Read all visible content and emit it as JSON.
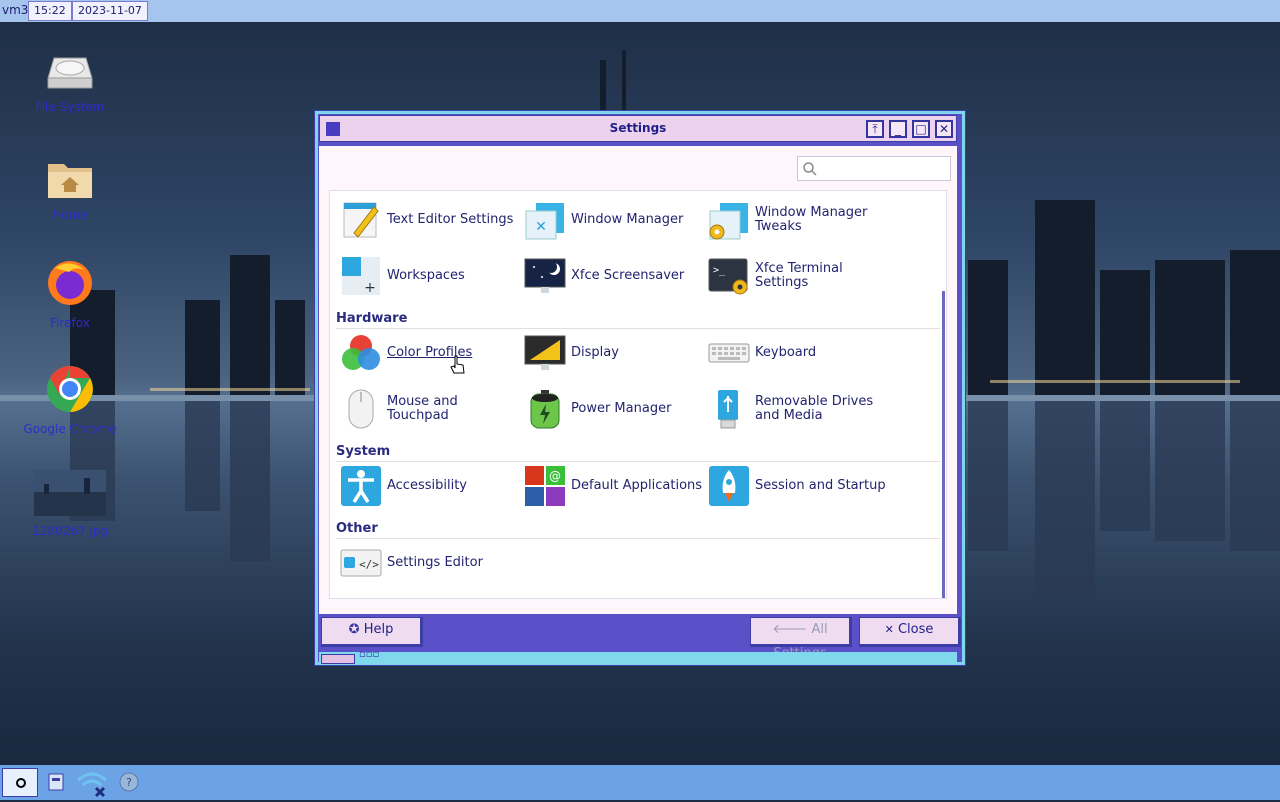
{
  "top_panel": {
    "workspace": "vm3",
    "time": "15:22",
    "date": "2023-11-07"
  },
  "desktop_icons": [
    {
      "label": "File System",
      "icon": "drive-icon"
    },
    {
      "label": "Home",
      "icon": "home-folder-icon"
    },
    {
      "label": "Firefox",
      "icon": "firefox-icon"
    },
    {
      "label": "Google Chrome",
      "icon": "chrome-icon"
    },
    {
      "label": "1280267.jpg",
      "icon": "image-thumbnail-icon"
    }
  ],
  "window": {
    "title": "Settings",
    "search_placeholder": "",
    "sections": [
      {
        "heading": "",
        "items": [
          {
            "label": "Text Editor Settings",
            "icon": "text-editor-settings-icon"
          },
          {
            "label": "Window Manager",
            "icon": "window-manager-icon"
          },
          {
            "label": "Window Manager Tweaks",
            "icon": "window-manager-tweaks-icon"
          },
          {
            "label": "Workspaces",
            "icon": "workspaces-icon"
          },
          {
            "label": "Xfce Screensaver",
            "icon": "screensaver-icon"
          },
          {
            "label": "Xfce Terminal Settings",
            "icon": "terminal-settings-icon"
          }
        ]
      },
      {
        "heading": "Hardware",
        "items": [
          {
            "label": "Color Profiles",
            "icon": "color-profiles-icon"
          },
          {
            "label": "Display",
            "icon": "display-icon"
          },
          {
            "label": "Keyboard",
            "icon": "keyboard-icon"
          },
          {
            "label": "Mouse and Touchpad",
            "icon": "mouse-icon"
          },
          {
            "label": "Power Manager",
            "icon": "battery-icon"
          },
          {
            "label": "Removable Drives and Media",
            "icon": "usb-drive-icon"
          }
        ]
      },
      {
        "heading": "System",
        "items": [
          {
            "label": "Accessibility",
            "icon": "accessibility-icon"
          },
          {
            "label": "Default Applications",
            "icon": "default-applications-icon"
          },
          {
            "label": "Session and Startup",
            "icon": "rocket-icon"
          }
        ]
      },
      {
        "heading": "Other",
        "items": [
          {
            "label": "Settings Editor",
            "icon": "settings-editor-icon"
          }
        ]
      }
    ],
    "buttons": {
      "help": "Help",
      "all_settings": "All Settings",
      "close": "Close"
    }
  },
  "colors": {
    "accent": "#3d3da8",
    "title_bg": "#ecd2ec",
    "panel_top": "#a6c5ee",
    "panel_bottom": "#6ba3e6"
  }
}
